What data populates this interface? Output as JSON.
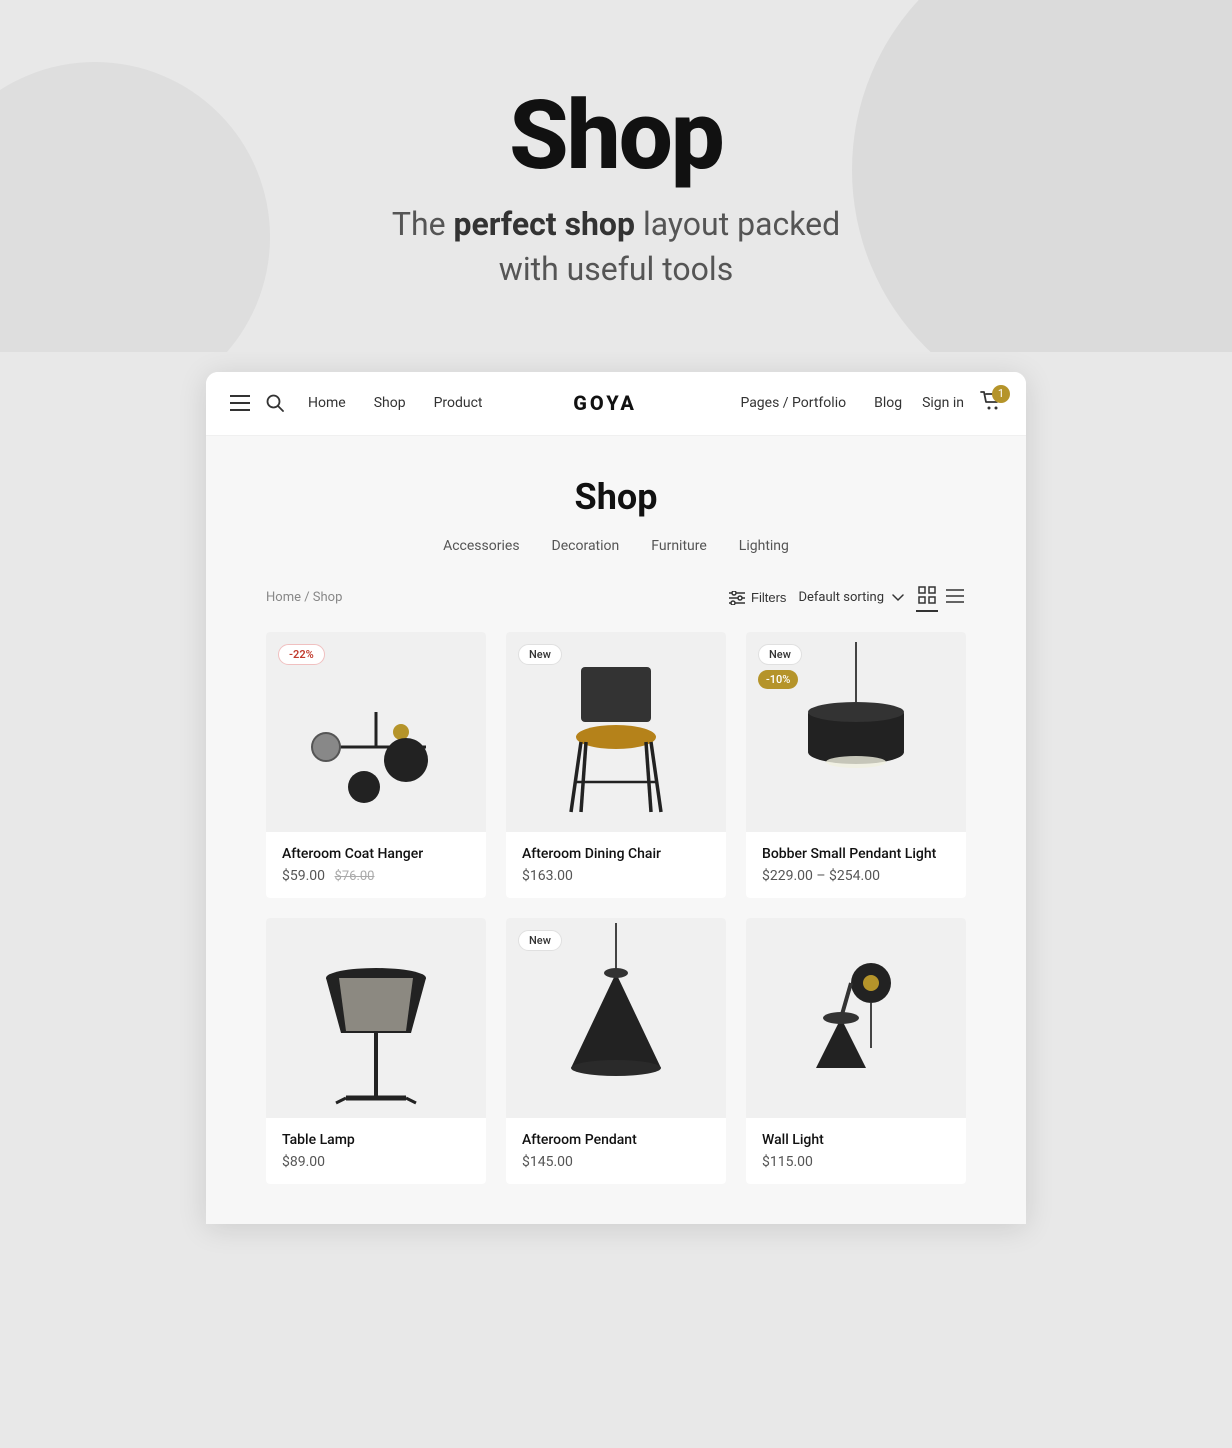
{
  "hero": {
    "title": "Shop",
    "subtitle_normal": "The ",
    "subtitle_bold": "perfect shop",
    "subtitle_end": " layout packed\nwith useful tools"
  },
  "navbar": {
    "links_left": [
      "Home",
      "Shop",
      "Product"
    ],
    "logo": "GOYA",
    "links_right": [
      "Pages / Portfolio",
      "Blog"
    ],
    "sign_in": "Sign in",
    "cart_count": "1"
  },
  "shop": {
    "title": "Shop",
    "categories": [
      "Accessories",
      "Decoration",
      "Furniture",
      "Lighting"
    ],
    "breadcrumb": "Home / Shop",
    "filter_label": "Filters",
    "sort_label": "Default sorting",
    "products": [
      {
        "name": "Afteroom Coat Hanger",
        "price": "$59.00",
        "price_original": "$76.00",
        "badge": "-22%",
        "badge_type": "sale"
      },
      {
        "name": "Afteroom Dining Chair",
        "price": "$163.00",
        "price_original": "",
        "badge": "New",
        "badge_type": "new"
      },
      {
        "name": "Bobber Small Pendant Light",
        "price": "$229.00 – $254.00",
        "price_original": "",
        "badge_top": "New",
        "badge_bottom": "-10%",
        "badge_type": "dual"
      },
      {
        "name": "Table Lamp",
        "price": "$89.00",
        "price_original": "",
        "badge": "",
        "badge_type": "none"
      },
      {
        "name": "Afteroom Pendant",
        "price": "$145.00",
        "price_original": "",
        "badge": "New",
        "badge_type": "new"
      },
      {
        "name": "Wall Light",
        "price": "$115.00",
        "price_original": "",
        "badge": "",
        "badge_type": "none"
      }
    ]
  }
}
